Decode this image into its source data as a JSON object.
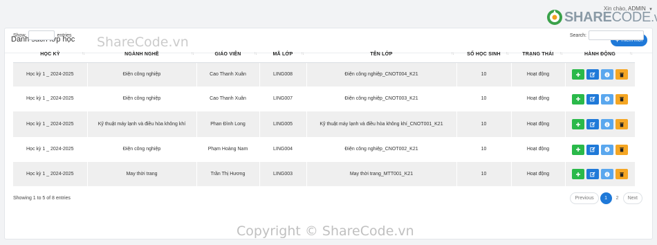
{
  "header": {
    "greeting": "Xin chào,",
    "user": "ADMIN",
    "logo_share": "SHARE",
    "logo_code": "CODE",
    "logo_vn": ".vn"
  },
  "card": {
    "title": "Danh sách lớp học",
    "add_label": "Thêm mới"
  },
  "controls": {
    "show_label": "Show",
    "entries_label": "entries",
    "search_label": "Search:"
  },
  "watermark": "ShareCode.vn",
  "table": {
    "columns": [
      "HỌC KỲ",
      "NGÀNH NGHỀ",
      "GIÁO VIÊN",
      "MÃ LỚP",
      "TÊN LỚP",
      "SỐ HỌC SINH",
      "TRẠNG THÁI",
      "HÀNH ĐỘNG"
    ],
    "sort_icon": "↑↓",
    "rows": [
      [
        "Học kỳ 1 _ 2024-2025",
        "Điện công nghiệp",
        "Cao Thanh Xuân",
        "LING008",
        "Điện công nghiệp_CNOT004_K21",
        "10",
        "Hoạt động"
      ],
      [
        "Học kỳ 1 _ 2024-2025",
        "Điện công nghiệp",
        "Cao Thanh Xuân",
        "LING007",
        "Điện công nghiệp_CNOT003_K21",
        "10",
        "Hoạt động"
      ],
      [
        "Học kỳ 1 _ 2024-2025",
        "Kỹ thuật máy lạnh và điều hòa không khí",
        "Phan Đình Long",
        "LING005",
        "Kỹ thuật máy lạnh và điều hòa không khí_CNOT001_K21",
        "10",
        "Hoạt động"
      ],
      [
        "Học kỳ 1 _ 2024-2025",
        "Điện công nghiệp",
        "Phạm Hoàng Nam",
        "LING004",
        "Điện công nghiệp_CNOT002_K21",
        "10",
        "Hoạt động"
      ],
      [
        "Học kỳ 1 _ 2024-2025",
        "May thời trang",
        "Trần Thị Hương",
        "LING003",
        "May thời trang_MTT001_K21",
        "10",
        "Hoạt động"
      ]
    ]
  },
  "footer": {
    "info": "Showing 1 to 5 of 8 entries",
    "previous": "Previous",
    "page1": "1",
    "page2": "2",
    "next": "Next"
  },
  "copyright": "Copyright © ShareCode.vn",
  "colors": {
    "primary": "#1f79d8",
    "success": "#2ab94a",
    "info": "#5aa7ee",
    "warning": "#f5a623",
    "status_text": "#2e9b3c"
  }
}
